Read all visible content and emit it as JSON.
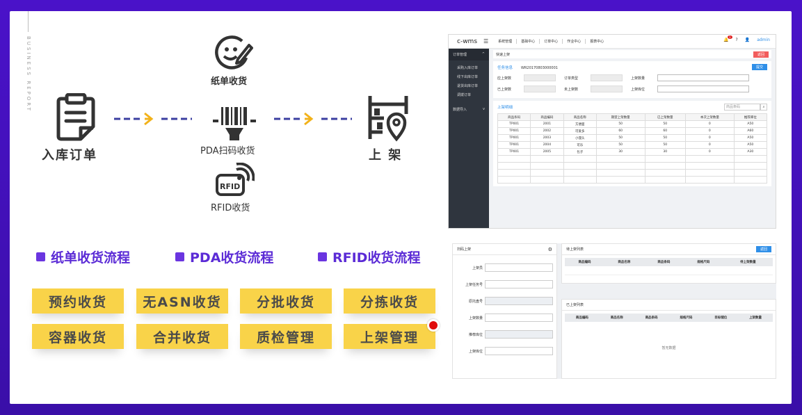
{
  "side_text": "BUSINESS REPORT",
  "flow": {
    "inbound_order": "入库订单",
    "paper": "纸单收货",
    "pda": "PDA扫码收货",
    "rfid": "RFID收货",
    "shelving": "上 架"
  },
  "bullets": [
    "纸单收货流程",
    "PDA收货流程",
    "RFID收货流程"
  ],
  "tags_row1": [
    "预约收货",
    "无ASN收货",
    "分批收货",
    "分拣收货"
  ],
  "tags_row2": [
    "容器收货",
    "合并收货",
    "质检管理",
    "上架管理"
  ],
  "colors": {
    "accent": "#5b2bd6",
    "tag": "#f9d349",
    "dot": "#e00b0b"
  },
  "shot1": {
    "logo": "c-wms",
    "menu": [
      "系统管理",
      "基础中心",
      "订单中心",
      "作业中心",
      "报表中心"
    ],
    "notify_count": "1",
    "user": "admin",
    "side_group": "订单管理",
    "side_items": [
      "采购入库订单",
      "线下出库订单",
      "退货出库订单",
      "调拨订单"
    ],
    "side_group2": "数据导入",
    "breadcrumb": "快速上架",
    "back": "返回",
    "task_label": "任务信息",
    "task_no": "WR20170803000001",
    "submit": "提交",
    "fields": {
      "should_qty": "应上架数",
      "order_type": "订单类型",
      "shelf_qty": "上架数量",
      "done_qty": "已上架数",
      "undone_qty": "未上架数",
      "shelf_loc": "上架库位"
    },
    "detail_title": "上架明细",
    "search_placeholder": "商品条码",
    "columns": [
      "商品条码",
      "商品编码",
      "商品名称",
      "期望上架数量",
      "已上架数量",
      "本次上架数量",
      "推荐库位"
    ],
    "rows": [
      [
        "TP001",
        "2001",
        "方便面",
        "50",
        "50",
        "0",
        "A50"
      ],
      [
        "TP001",
        "2002",
        "可爱多",
        "60",
        "60",
        "0",
        "A60"
      ],
      [
        "TP001",
        "2003",
        "小馒头",
        "50",
        "50",
        "0",
        "A50"
      ],
      [
        "TP001",
        "2004",
        "可乐",
        "50",
        "50",
        "0",
        "A50"
      ],
      [
        "TP001",
        "2005",
        "包子",
        "30",
        "30",
        "0",
        "A30"
      ]
    ]
  },
  "shot2": {
    "scan_title": "扫码上架",
    "fields": [
      "上架员",
      "上架任务号",
      "原托盘号",
      "上架数量",
      "推荐库位",
      "上架库位"
    ],
    "pending_title": "待上架列表",
    "back": "返回",
    "pending_cols": [
      "商品编码",
      "商品名称",
      "商品条码",
      "规格尺码",
      "待上架数量"
    ],
    "done_title": "已上架列表",
    "done_cols": [
      "商品编码",
      "商品名称",
      "商品条码",
      "规格尺码",
      "目标储位",
      "上架数量"
    ],
    "empty": "暂无数据"
  }
}
